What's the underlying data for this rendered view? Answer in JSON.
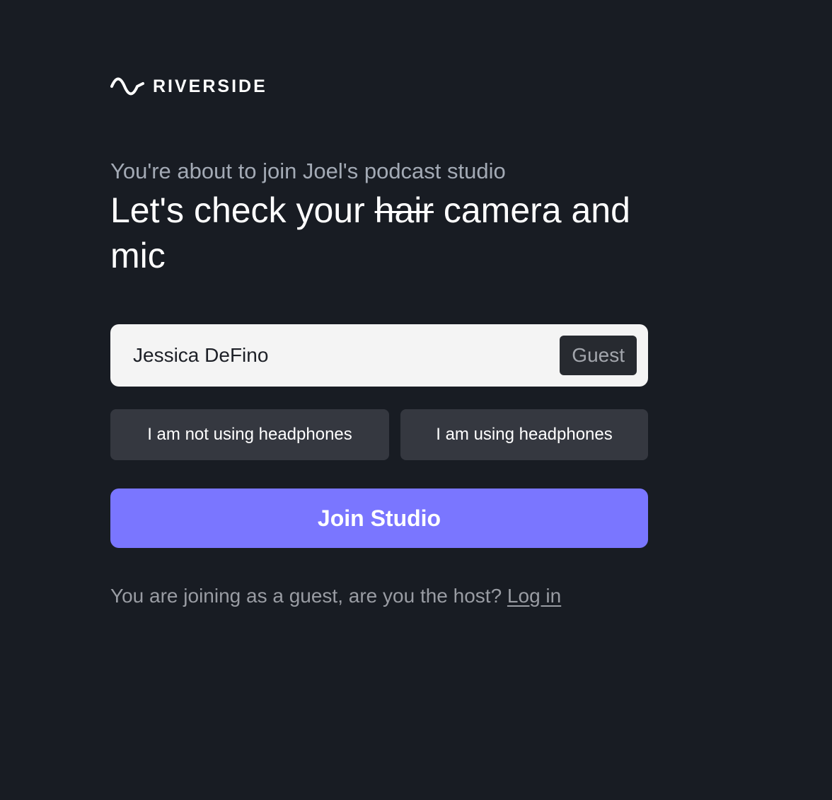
{
  "brand": {
    "name": "RIVERSIDE",
    "logo_icon": "sine-wave-icon"
  },
  "intro": {
    "subtitle": "You're about to join Joel's podcast studio",
    "headline_before": "Let's check your ",
    "headline_struck": "hair",
    "headline_after": " camera and mic"
  },
  "name_field": {
    "value": "Jessica DeFino",
    "role_badge": "Guest"
  },
  "headphones": {
    "not_using_label": "I am not using headphones",
    "using_label": "I am using headphones"
  },
  "join_button": {
    "label": "Join Studio",
    "color": "#7a76ff"
  },
  "footer": {
    "text": "You are joining as a guest, are you the host? ",
    "login_link": "Log in"
  },
  "colors": {
    "background": "#181c23",
    "secondary_button": "#353840"
  }
}
